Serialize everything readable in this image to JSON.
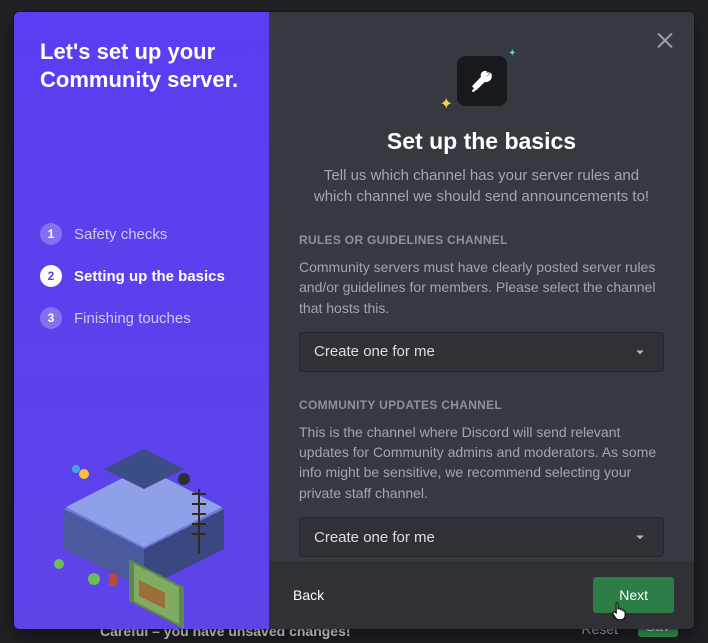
{
  "sidebar": {
    "title": "Let's set up your Community server.",
    "steps": [
      {
        "num": "1",
        "label": "Safety checks"
      },
      {
        "num": "2",
        "label": "Setting up the basics"
      },
      {
        "num": "3",
        "label": "Finishing touches"
      }
    ],
    "activeStepIndex": 1
  },
  "main": {
    "heading": "Set up the basics",
    "subtitle": "Tell us which channel has your server rules and which channel we should send announcements to!",
    "sections": [
      {
        "label": "RULES OR GUIDELINES CHANNEL",
        "desc": "Community servers must have clearly posted server rules and/or guidelines for members. Please select the channel that hosts this.",
        "selectValue": "Create one for me"
      },
      {
        "label": "COMMUNITY UPDATES CHANNEL",
        "desc": "This is the channel where Discord will send relevant updates for Community admins and moderators. As some info might be sensitive, we recommend selecting your private staff channel.",
        "selectValue": "Create one for me"
      }
    ]
  },
  "footer": {
    "back": "Back",
    "next": "Next"
  },
  "behind": {
    "warning": "Careful – you have unsaved changes!",
    "reset": "Reset",
    "save": "Sav"
  }
}
